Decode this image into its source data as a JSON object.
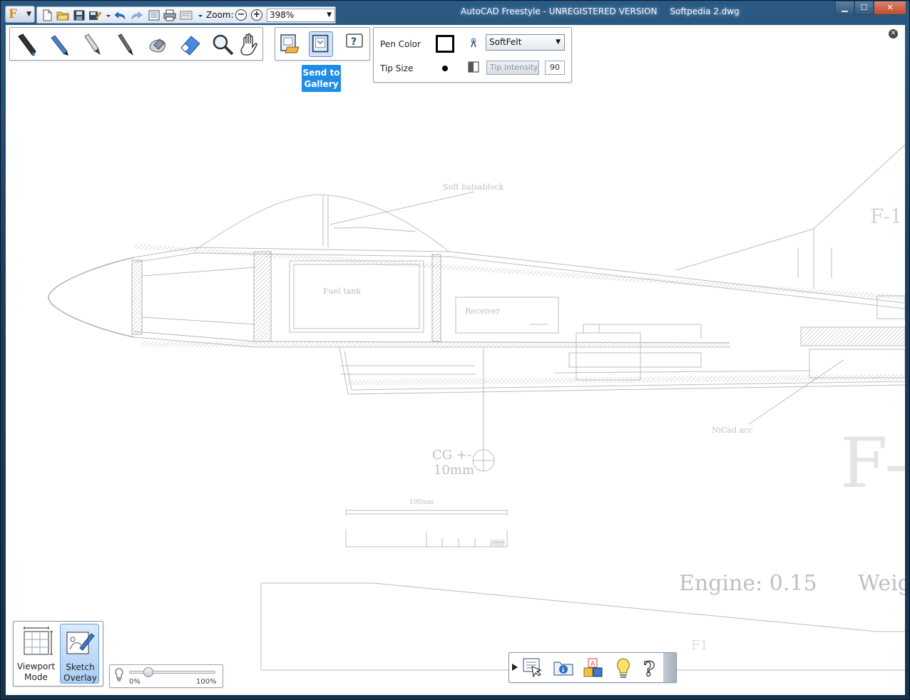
{
  "window": {
    "app_title": "AutoCAD Freestyle - UNREGISTERED VERSION",
    "document_title": "Softpedia 2.dwg",
    "minimize_label": "▁",
    "maximize_label": "☐",
    "close_label": "✕"
  },
  "toolbar": {
    "zoom_label": "Zoom:",
    "zoom_value": "398%"
  },
  "gallery": {
    "tooltip": "Send to Gallery"
  },
  "pen_panel": {
    "pen_color_label": "Pen Color",
    "tip_size_label": "Tip Size",
    "brush": "SoftFelt",
    "tip_intensity_placeholder": "Tip intensity",
    "tip_intensity_value": "90",
    "pen_color": "#000000"
  },
  "modes": {
    "viewport_label_line1": "Viewport",
    "viewport_label_line2": "Mode",
    "sketch_label_line1": "Sketch",
    "sketch_label_line2": "Overlay"
  },
  "opacity": {
    "min_label": "0%",
    "max_label": "100%",
    "value_percent": 22
  },
  "drawing": {
    "labels": {
      "soft_balsa": "Soft balsablock",
      "fuel_tank": "Fuel tank",
      "receiver": "Receiver",
      "nicad": "NiCad acc",
      "cg_line1": "CG +-",
      "cg_line2": "10mm",
      "scale": "100mm",
      "engine": "Engine: 0.15",
      "weight": "Weig",
      "big_title": "F-",
      "small_title": "F-1",
      "f1": "F1"
    }
  }
}
